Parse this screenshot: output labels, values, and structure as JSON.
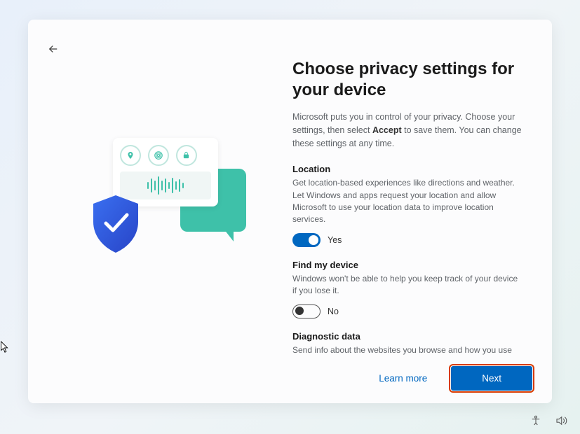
{
  "header": {
    "title": "Choose privacy settings for your device",
    "description_pre": "Microsoft puts you in control of your privacy. Choose your settings, then select ",
    "description_bold": "Accept",
    "description_post": " to save them. You can change these settings at any time."
  },
  "settings": [
    {
      "title": "Location",
      "description": "Get location-based experiences like directions and weather. Let Windows and apps request your location and allow Microsoft to use your location data to improve location services.",
      "on": true,
      "state_label": "Yes"
    },
    {
      "title": "Find my device",
      "description": "Windows won't be able to help you keep track of your device if you lose it.",
      "on": false,
      "state_label": "No"
    },
    {
      "title": "Diagnostic data",
      "description": "Send info about the websites you browse and how you use apps and features, plus additional info about device health, device activity, and enhanced error reporting. Required diagnostic data will always be included when",
      "on": null,
      "state_label": ""
    }
  ],
  "footer": {
    "learn_more": "Learn more",
    "next": "Next"
  }
}
